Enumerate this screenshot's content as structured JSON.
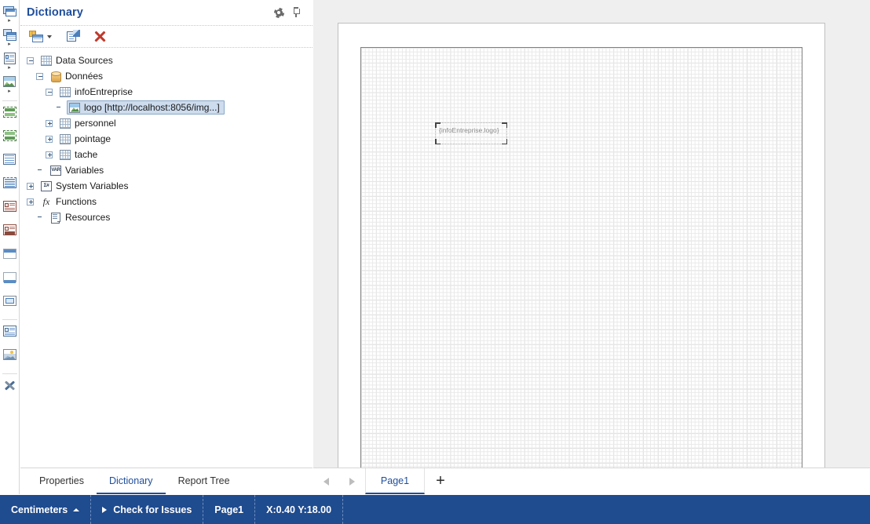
{
  "panel": {
    "title": "Dictionary",
    "header_buttons": [
      {
        "name": "gear-icon",
        "title": "Settings"
      },
      {
        "name": "pin-icon",
        "title": "Pin"
      }
    ],
    "toolbar": [
      {
        "name": "new-item-button",
        "title": "New Item"
      },
      {
        "name": "edit-button",
        "title": "Edit"
      },
      {
        "name": "delete-button",
        "title": "Delete"
      }
    ],
    "tabs": [
      {
        "label": "Properties",
        "active": false
      },
      {
        "label": "Dictionary",
        "active": true
      },
      {
        "label": "Report Tree",
        "active": false
      }
    ]
  },
  "tree": [
    {
      "label": "Data Sources",
      "indent": 0,
      "expander": "minus",
      "icon": "table",
      "selected": false
    },
    {
      "label": "Données",
      "indent": 1,
      "expander": "minus",
      "icon": "db",
      "selected": false
    },
    {
      "label": "infoEntreprise",
      "indent": 2,
      "expander": "minus",
      "icon": "table",
      "selected": false
    },
    {
      "label": "logo [http://localhost:8056/img...]",
      "indent": 3,
      "expander": "none",
      "icon": "image",
      "selected": true
    },
    {
      "label": "personnel",
      "indent": 2,
      "expander": "plus",
      "icon": "table",
      "selected": false
    },
    {
      "label": "pointage",
      "indent": 2,
      "expander": "plus",
      "icon": "table",
      "selected": false
    },
    {
      "label": "tache",
      "indent": 2,
      "expander": "plus",
      "icon": "table",
      "selected": false
    },
    {
      "label": "Variables",
      "indent": 1,
      "expander": "none",
      "icon": "var",
      "selected": false,
      "icon_text": "VAR"
    },
    {
      "label": "System Variables",
      "indent": 0,
      "expander": "plus",
      "icon": "sysvar",
      "selected": false,
      "icon_text": "Σ#"
    },
    {
      "label": "Functions",
      "indent": 0,
      "expander": "plus",
      "icon": "fx",
      "selected": false,
      "icon_text": "fx"
    },
    {
      "label": "Resources",
      "indent": 1,
      "expander": "none",
      "icon": "resource",
      "selected": false
    }
  ],
  "toolbox": [
    {
      "name": "report-band-tool",
      "arrow": true
    },
    {
      "name": "data-band-tool",
      "arrow": true
    },
    {
      "name": "card-tool",
      "arrow": true
    },
    {
      "name": "image-band-tool",
      "arrow": true
    },
    {
      "name": "header-band-tool",
      "arrow": false
    },
    {
      "name": "footer-band-tool",
      "arrow": false
    },
    {
      "name": "page-header-tool",
      "arrow": false
    },
    {
      "name": "text-block-tool",
      "arrow": false
    },
    {
      "name": "group-header-tool",
      "arrow": false
    },
    {
      "name": "group-footer-tool",
      "arrow": false
    },
    {
      "name": "panel-top-tool",
      "arrow": false
    },
    {
      "name": "panel-bottom-tool",
      "arrow": false
    },
    {
      "name": "child-band-tool",
      "arrow": false
    },
    {
      "name": "text-component-tool",
      "arrow": false
    },
    {
      "name": "image-component-tool",
      "arrow": false
    },
    {
      "name": "tools-tool",
      "arrow": false
    }
  ],
  "canvas": {
    "placeholder_text": "{infoEntreprise.logo}"
  },
  "pagebar": {
    "prev_label": "Previous page",
    "next_label": "Next page",
    "tabs": [
      {
        "label": "Page1",
        "active": true
      }
    ],
    "add_label": "+"
  },
  "statusbar": {
    "units": "Centimeters",
    "check_issues": "Check for Issues",
    "page": "Page1",
    "coords": "X:0.40 Y:18.00"
  },
  "colors": {
    "accent": "#1f4e9c",
    "statusbar": "#1f4b8f",
    "selection": "#cddcee",
    "canvas_bg": "#efefef"
  }
}
